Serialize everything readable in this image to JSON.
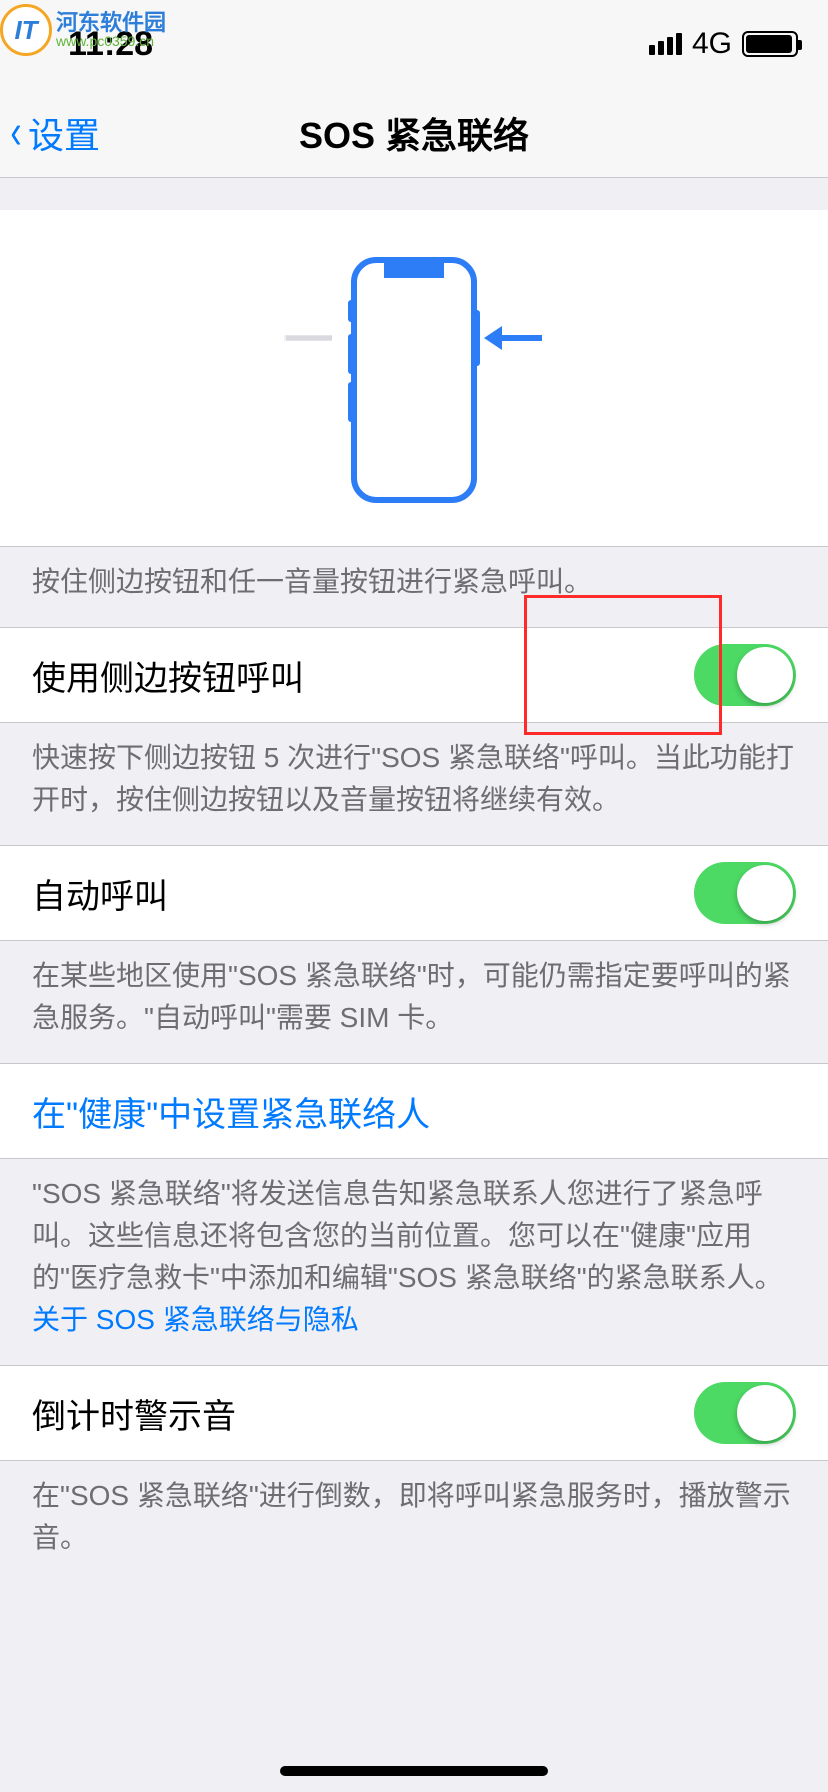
{
  "watermark": {
    "title": "河东软件园",
    "url": "www.pc0359.cn"
  },
  "status": {
    "time": "11:28",
    "network": "4G"
  },
  "nav": {
    "back": "设置",
    "title": "SOS 紧急联络"
  },
  "hero": {
    "caption": "按住侧边按钮和任一音量按钮进行紧急呼叫。"
  },
  "settings": {
    "side_button": {
      "label": "使用侧边按钮呼叫",
      "footer": "快速按下侧边按钮 5 次进行\"SOS 紧急联络\"呼叫。当此功能打开时，按住侧边按钮以及音量按钮将继续有效。"
    },
    "auto_call": {
      "label": "自动呼叫",
      "footer": "在某些地区使用\"SOS 紧急联络\"时，可能仍需指定要呼叫的紧急服务。\"自动呼叫\"需要 SIM 卡。"
    },
    "health": {
      "label": "在\"健康\"中设置紧急联络人",
      "footer": "\"SOS 紧急联络\"将发送信息告知紧急联系人您进行了紧急呼叫。这些信息还将包含您的当前位置。您可以在\"健康\"应用的\"医疗急救卡\"中添加和编辑\"SOS 紧急联络\"的紧急联系人。",
      "link": "关于 SOS 紧急联络与隐私"
    },
    "countdown": {
      "label": "倒计时警示音",
      "footer": "在\"SOS 紧急联络\"进行倒数，即将呼叫紧急服务时，播放警示音。"
    }
  }
}
